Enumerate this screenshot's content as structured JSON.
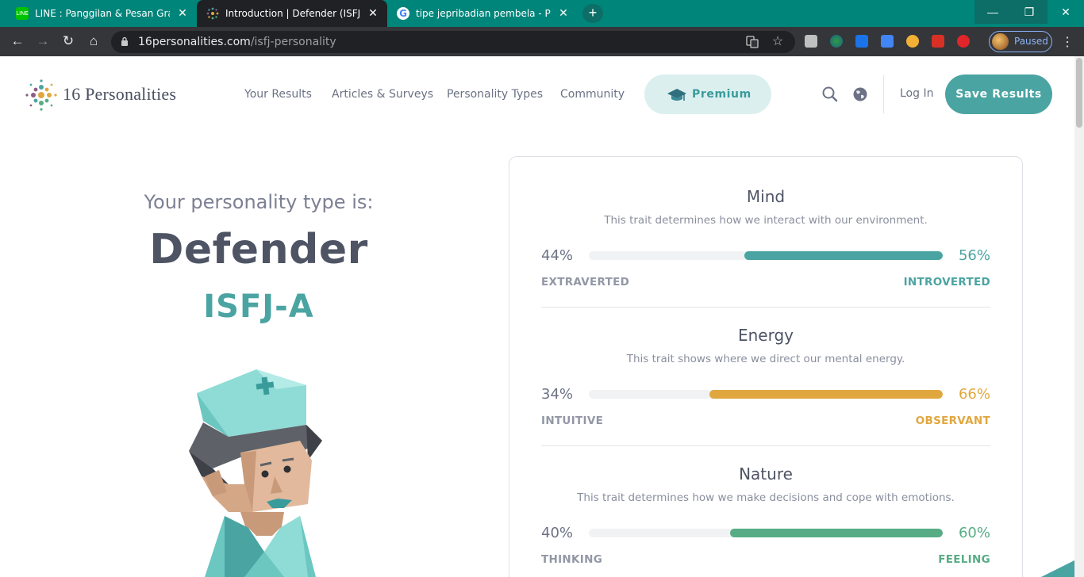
{
  "browser": {
    "tabs": [
      {
        "title": "LINE : Panggilan & Pesan Gratis",
        "close": "✕",
        "favicon": "line-icon",
        "color": "#00c300"
      },
      {
        "title": "Introduction | Defender (ISFJ) Personality",
        "close": "✕",
        "favicon": "16personalities-icon"
      },
      {
        "title": "tipe jepribadian pembela - Penelusuran Google",
        "close": "✕",
        "favicon": "google-icon"
      }
    ],
    "new_tab": "+",
    "window_controls": {
      "minimize": "—",
      "restore": "❐",
      "close": "✕"
    },
    "nav": {
      "back": "←",
      "forward": "→",
      "reload": "↻",
      "home": "⌂"
    },
    "url_host": "16personalities.com",
    "url_path": "/isfj-personality",
    "profile_status": "Paused",
    "menu": "⋮"
  },
  "site": {
    "logo_text": "16 Personalities",
    "nav": [
      "Your Results",
      "Articles & Surveys",
      "Personality Types",
      "Community"
    ],
    "premium_label": "Premium",
    "login_label": "Log In",
    "save_label": "Save Results"
  },
  "result": {
    "label": "Your personality type is:",
    "name": "Defender",
    "code": "ISFJ-A"
  },
  "traits": [
    {
      "title": "Mind",
      "description": "This trait determines how we interact with our environment.",
      "left_pct": "44%",
      "right_pct": "56%",
      "left_label": "EXTRAVERTED",
      "right_label": "INTROVERTED",
      "right_value": 56,
      "color": "#4aa4a2"
    },
    {
      "title": "Energy",
      "description": "This trait shows where we direct our mental energy.",
      "left_pct": "34%",
      "right_pct": "66%",
      "left_label": "INTUITIVE",
      "right_label": "OBSERVANT",
      "right_value": 66,
      "color": "#e1a73f"
    },
    {
      "title": "Nature",
      "description": "This trait determines how we make decisions and cope with emotions.",
      "left_pct": "40%",
      "right_pct": "60%",
      "left_label": "THINKING",
      "right_label": "FEELING",
      "right_value": 60,
      "color": "#57ac85"
    }
  ]
}
